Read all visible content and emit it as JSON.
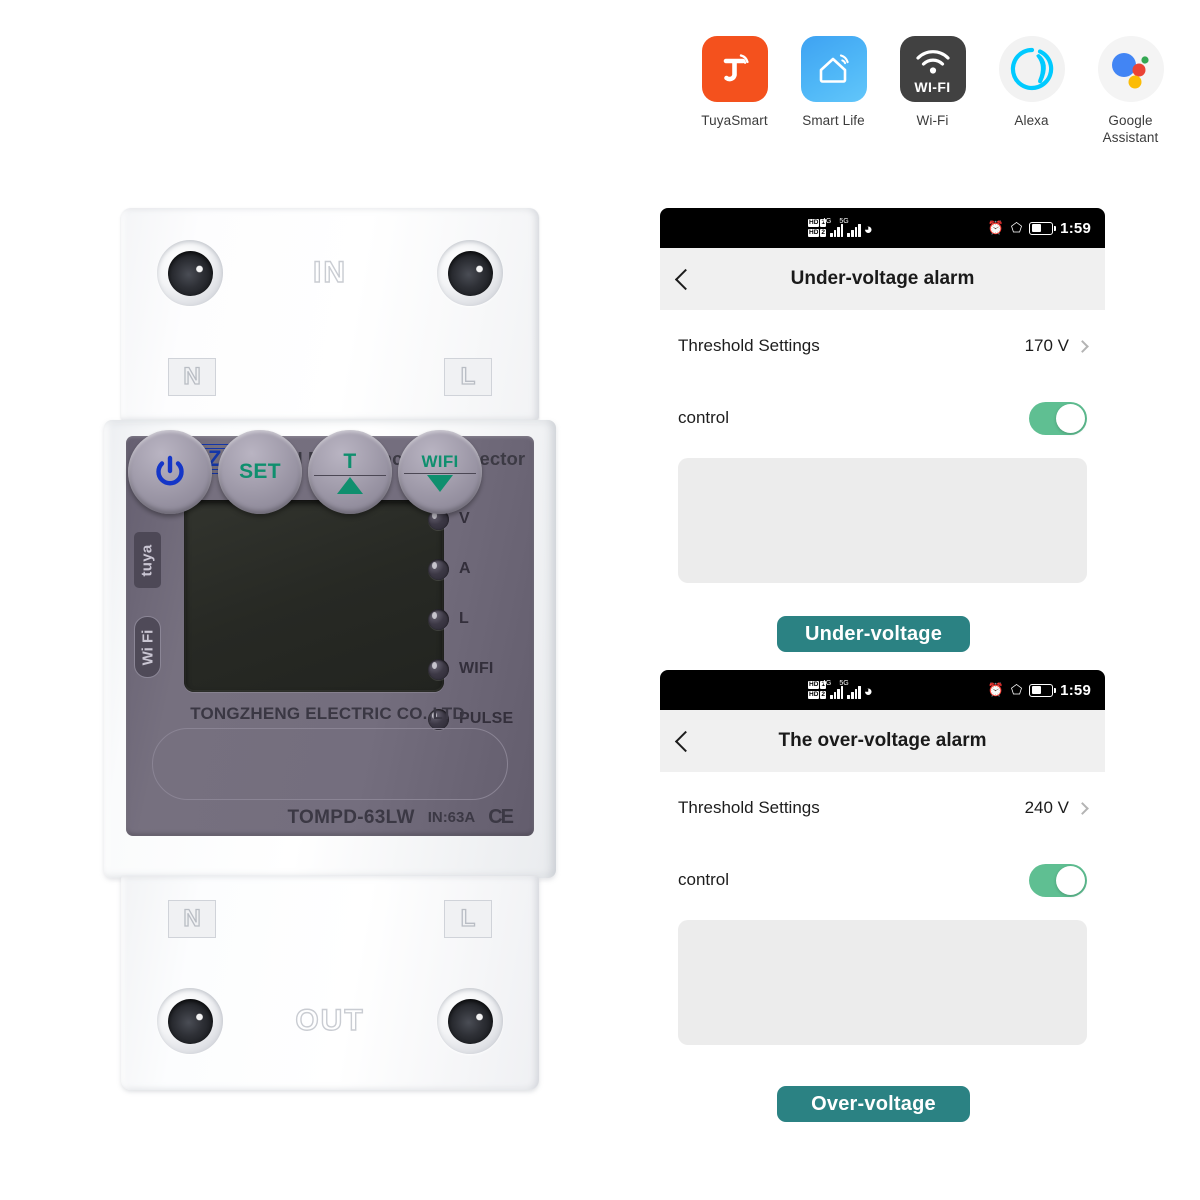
{
  "ecosystem": {
    "items": [
      {
        "label": "TuyaSmart",
        "icon": "tuya-icon",
        "color": "#f4511d"
      },
      {
        "label": "Smart Life",
        "icon": "smart-life-house-icon",
        "color": "#3ea2f2"
      },
      {
        "label": "Wi-Fi",
        "icon": "wifi-icon",
        "badge_text": "WI-FI",
        "color": "#414141"
      },
      {
        "label": "Alexa",
        "icon": "alexa-icon",
        "color": "#00caff"
      },
      {
        "label": "Google\nAssistant",
        "icon": "google-assistant-icon",
        "color": "#4285f4"
      }
    ]
  },
  "device": {
    "brand": "TOMZN",
    "title": "WIFI Multi-Function Protector",
    "company": "TONGZHENG ELECTRIC CO.,LTD.",
    "model": "TOMPD-63LW",
    "current_rating": "IN:63A",
    "certification": "CE",
    "side_badges": [
      {
        "name": "tuya-badge",
        "text": "tuya"
      },
      {
        "name": "wifi-badge",
        "text": "Wi Fi"
      }
    ],
    "top_port_label": "IN",
    "bottom_port_label": "OUT",
    "top_terminals": [
      "N",
      "L"
    ],
    "bottom_terminals": [
      "N",
      "L"
    ],
    "leds": [
      "V",
      "A",
      "L",
      "WIFI",
      "PULSE"
    ],
    "buttons": [
      {
        "name": "power-button",
        "label": "",
        "icon": "power-icon",
        "color": "#1436c8"
      },
      {
        "name": "set-button",
        "label": "SET",
        "color": "#0f8f6e"
      },
      {
        "name": "t-up-button",
        "label": "T",
        "arrow": "up",
        "color": "#0f8f6e"
      },
      {
        "name": "wifi-down-button",
        "label": "WIFI",
        "arrow": "down",
        "color": "#0f8f6e"
      }
    ]
  },
  "phones": [
    {
      "status_bar": {
        "time": "1:59",
        "hd1": "HD",
        "hd1_num": "1",
        "hd2": "HD",
        "hd2_num": "2",
        "net_1": "4G",
        "net_2": "5G"
      },
      "app_title": "Under-voltage alarm",
      "rows": [
        {
          "label": "Threshold Settings",
          "value": "170 V",
          "type": "nav"
        },
        {
          "label": "control",
          "value": "on",
          "type": "toggle"
        }
      ],
      "caption": "Under-voltage"
    },
    {
      "status_bar": {
        "time": "1:59",
        "hd1": "HD",
        "hd1_num": "1",
        "hd2": "HD",
        "hd2_num": "2",
        "net_1": "4G",
        "net_2": "5G"
      },
      "app_title": "The over-voltage alarm",
      "rows": [
        {
          "label": "Threshold Settings",
          "value": "240 V",
          "type": "nav"
        },
        {
          "label": "control",
          "value": "on",
          "type": "toggle"
        }
      ],
      "caption": "Over-voltage"
    }
  ],
  "colors": {
    "toggle_on": "#5fbf92",
    "pill": "#2b8283",
    "faceplate": "#746e7e",
    "brand_blue": "#1436a8",
    "button_green": "#0f8f6e"
  }
}
